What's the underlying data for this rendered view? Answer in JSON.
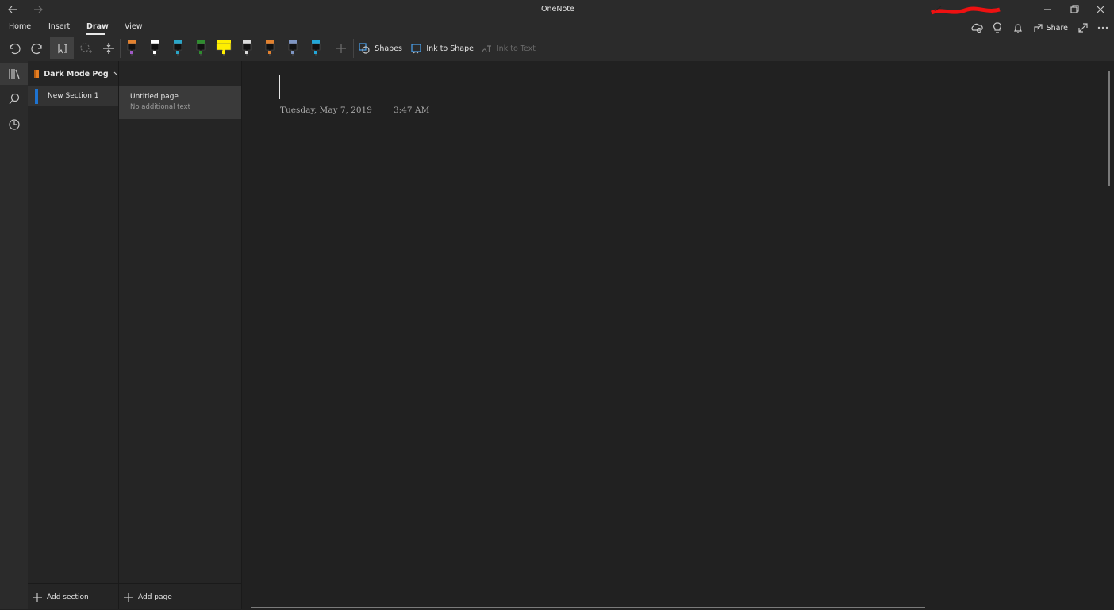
{
  "window": {
    "title": "OneNote"
  },
  "ribbon": {
    "tabs": [
      "Home",
      "Insert",
      "Draw",
      "View"
    ],
    "active_tab": "Draw",
    "right_actions": {
      "share_label": "Share"
    }
  },
  "draw_toolbar": {
    "pens": [
      {
        "name": "pen-orange-purple",
        "tip": "#e2812f",
        "band": "#a05ac7"
      },
      {
        "name": "pen-white",
        "tip": "#ffffff",
        "band": "#ffffff"
      },
      {
        "name": "pen-teal",
        "tip": "#2aa5c7",
        "band": "#2aa5c7"
      },
      {
        "name": "pen-green",
        "tip": "#2f8c2f",
        "band": "#2f8c2f"
      },
      {
        "name": "highlighter-yellow",
        "tip": "#ffee00",
        "band": "#ffee00"
      },
      {
        "name": "pen-silver",
        "tip": "#d9d9d9",
        "band": "#d9d9d9"
      },
      {
        "name": "pen-orange",
        "tip": "#e2812f",
        "band": "#e2812f"
      },
      {
        "name": "pen-steel-blue",
        "tip": "#7e95c2",
        "band": "#7e95c2"
      },
      {
        "name": "pen-cyan",
        "tip": "#22a7d8",
        "band": "#22a7d8"
      }
    ],
    "shapes_label": "Shapes",
    "ink_to_shape_label": "Ink to Shape",
    "ink_to_text_label": "Ink to Text"
  },
  "notebook": {
    "name": "Dark Mode Pog",
    "color": "#e67e22",
    "sections": [
      {
        "label": "New Section 1",
        "color": "#1e73d0"
      }
    ],
    "add_section_label": "Add section"
  },
  "pages": {
    "items": [
      {
        "title": "Untitled page",
        "preview": "No additional text"
      }
    ],
    "add_page_label": "Add page"
  },
  "page": {
    "date": "Tuesday, May 7, 2019",
    "time": "3:47 AM"
  }
}
